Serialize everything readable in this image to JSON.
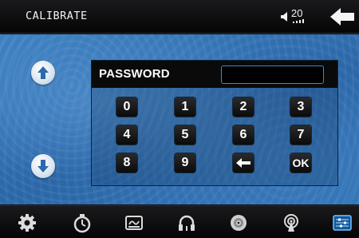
{
  "header": {
    "title": "CALIBRATE",
    "volume_value": "20",
    "back_icon": "back-arrow-icon"
  },
  "side_buttons": {
    "up_icon": "arrow-up-icon",
    "down_icon": "arrow-down-icon"
  },
  "password_panel": {
    "label": "PASSWORD",
    "value": "",
    "keys": [
      "0",
      "1",
      "2",
      "3",
      "4",
      "5",
      "6",
      "7",
      "8",
      "9",
      "←",
      "OK"
    ]
  },
  "bottom_nav": {
    "items": [
      "gear-icon",
      "timer-icon",
      "display-icon",
      "headphones-icon",
      "disc-icon",
      "antenna-icon",
      "screen-adjust-icon"
    ]
  },
  "colors": {
    "accent": "#2f8fd6",
    "background_blue": "#2f72b5",
    "bar": "#0a0a0b"
  }
}
